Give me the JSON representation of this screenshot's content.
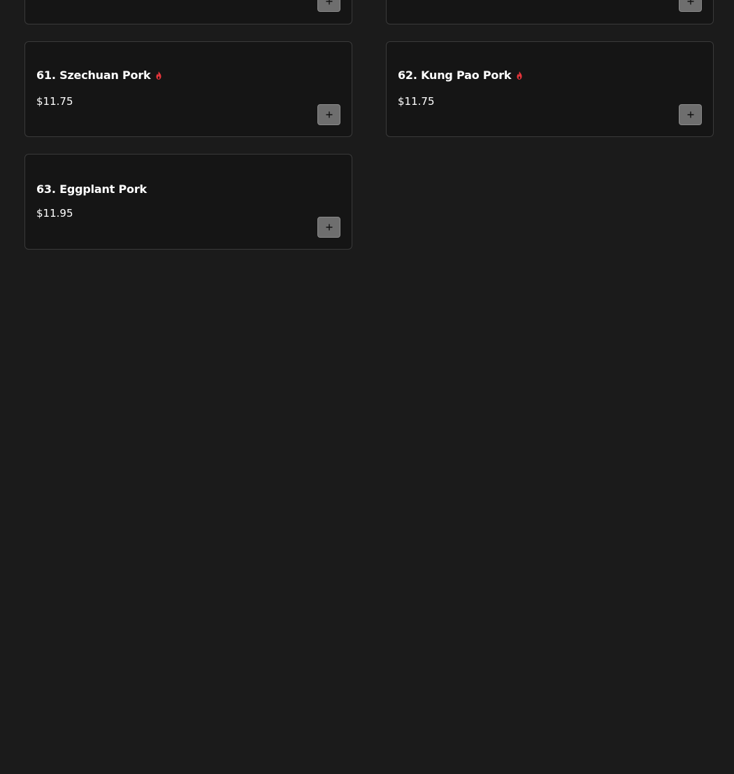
{
  "items": [
    {
      "name": "61. Szechuan Pork",
      "price": "$11.75",
      "spicy": true,
      "add_icon": "plus-icon"
    },
    {
      "name": "62. Kung Pao Pork",
      "price": "$11.75",
      "spicy": true,
      "add_icon": "plus-icon"
    },
    {
      "name": "63. Eggplant Pork",
      "price": "$11.95",
      "spicy": false,
      "add_icon": "plus-icon"
    }
  ],
  "colors": {
    "background": "#1b1b1b",
    "card_background": "#151515",
    "card_border": "#3a3a3a",
    "spicy_icon": "#e8353b",
    "add_button": "#6e6e6e"
  }
}
